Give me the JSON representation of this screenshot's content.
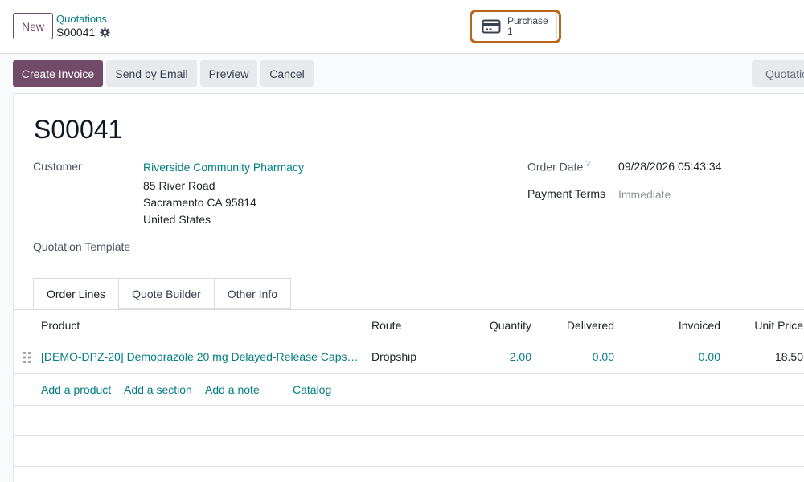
{
  "control_panel": {
    "new_label": "New",
    "breadcrumb": "Quotations",
    "record_name": "S00041",
    "smart_button": {
      "label": "Purchase",
      "count": "1"
    }
  },
  "actions": {
    "create_invoice": "Create Invoice",
    "send_by_email": "Send by Email",
    "preview": "Preview",
    "cancel": "Cancel",
    "status": "Quotation"
  },
  "form": {
    "title": "S00041",
    "customer_label": "Customer",
    "customer_name": "Riverside Community Pharmacy",
    "address": [
      "85 River Road",
      "Sacramento CA 95814",
      "United States"
    ],
    "quotation_template_label": "Quotation Template",
    "order_date_label": "Order Date",
    "order_date_help": "?",
    "order_date_value": "09/28/2026 05:43:34",
    "payment_terms_label": "Payment Terms",
    "payment_terms_value": "Immediate"
  },
  "tabs": [
    "Order Lines",
    "Quote Builder",
    "Other Info"
  ],
  "table": {
    "headers": [
      "Product",
      "Route",
      "Quantity",
      "Delivered",
      "Invoiced",
      "Unit Price"
    ],
    "rows": [
      {
        "product": "[DEMO-DPZ-20] Demoprazole 20 mg Delayed-Release Caps…",
        "route": "Dropship",
        "quantity": "2.00",
        "delivered": "0.00",
        "invoiced": "0.00",
        "unit_price": "18.50"
      }
    ],
    "add_links": [
      "Add a product",
      "Add a section",
      "Add a note",
      "Catalog"
    ]
  },
  "colors": {
    "brand": "#714b67",
    "link": "#017e84",
    "highlight": "#b9651b"
  },
  "icons": {
    "settings": "gear-icon",
    "purchase": "credit-card-icon",
    "drag": "drag-handle-icon"
  }
}
